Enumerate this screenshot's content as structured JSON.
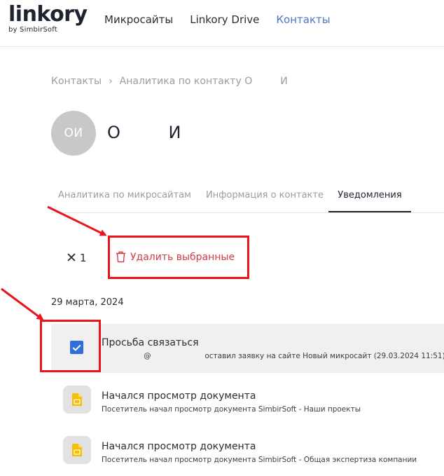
{
  "header": {
    "logo_main": "linkory",
    "logo_sub": "by SimbirSoft",
    "nav": [
      {
        "label": "Микросайты"
      },
      {
        "label": "Linkory Drive"
      },
      {
        "label": "Контакты"
      }
    ]
  },
  "breadcrumb": {
    "root": "Контакты",
    "separator": "›",
    "current": "Аналитика по контакту О         И"
  },
  "contact": {
    "initials": "ОИ",
    "name": "О         И"
  },
  "tabs": [
    {
      "label": "Аналитика по микросайтам"
    },
    {
      "label": "Информация о контакте"
    },
    {
      "label": "Уведомления"
    }
  ],
  "selection": {
    "close_symbol": "✕",
    "count": "1",
    "delete_label": "Удалить выбранные"
  },
  "date_group": "29 марта, 2024",
  "notifications": [
    {
      "title": "Просьба связаться",
      "description": "                  @                       оставил заявку на сайте Новый микросайт (29.03.2024 11:51)"
    },
    {
      "title": "Начался просмотр документа",
      "description": "Посетитель начал просмотр документа SimbirSoft - Наши проекты"
    },
    {
      "title": "Начался просмотр документа",
      "description": "Посетитель начал просмотр документа SimbirSoft - Общая экспертиза компании"
    }
  ],
  "colors": {
    "accent_link": "#4b76c8",
    "delete_red": "#d23b4a",
    "checkbox_blue": "#2f6fd8",
    "annotation_red": "#e8151c",
    "doc_icon_yellow": "#f5c000"
  }
}
